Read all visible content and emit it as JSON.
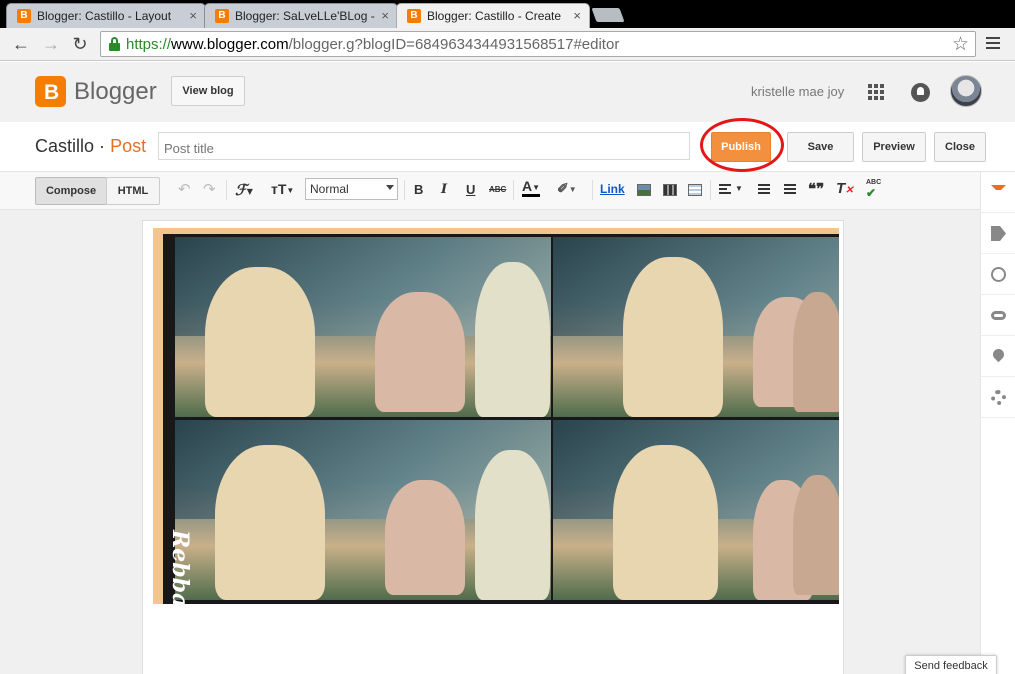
{
  "browser": {
    "tabs": [
      {
        "title": "Blogger: Castillo - Layout"
      },
      {
        "title": "Blogger: SaLveLLe'BLog -"
      },
      {
        "title": "Blogger: Castillo - Create"
      }
    ],
    "url_scheme": "https://",
    "url_host": "www.blogger.com",
    "url_path": "/blogger.g?blogID=6849634344931568517#editor"
  },
  "header": {
    "brand": "Blogger",
    "view_blog_label": "View blog",
    "username": "kristelle mae joy"
  },
  "titlebar": {
    "blog_name": "Castillo",
    "separator": "·",
    "section": "Post",
    "post_title_placeholder": "Post title",
    "publish_label": "Publish",
    "save_label": "Save",
    "preview_label": "Preview",
    "close_label": "Close"
  },
  "editor_toolbar": {
    "compose_label": "Compose",
    "html_label": "HTML",
    "font_label": "ℱ",
    "size_label": "тT",
    "style_value": "Normal",
    "bold": "B",
    "italic": "I",
    "underline": "U",
    "strike": "ABC",
    "textcolor": "A",
    "link_label": "Link",
    "quote": "❝❞",
    "removeformat": "T",
    "spell": "ABC"
  },
  "content": {
    "watermark": "Rebba"
  },
  "footer": {
    "feedback_label": "Send feedback"
  },
  "colors": {
    "accent": "#f57d00",
    "publish": "#f3903f",
    "highlight_circle": "#e41616"
  }
}
